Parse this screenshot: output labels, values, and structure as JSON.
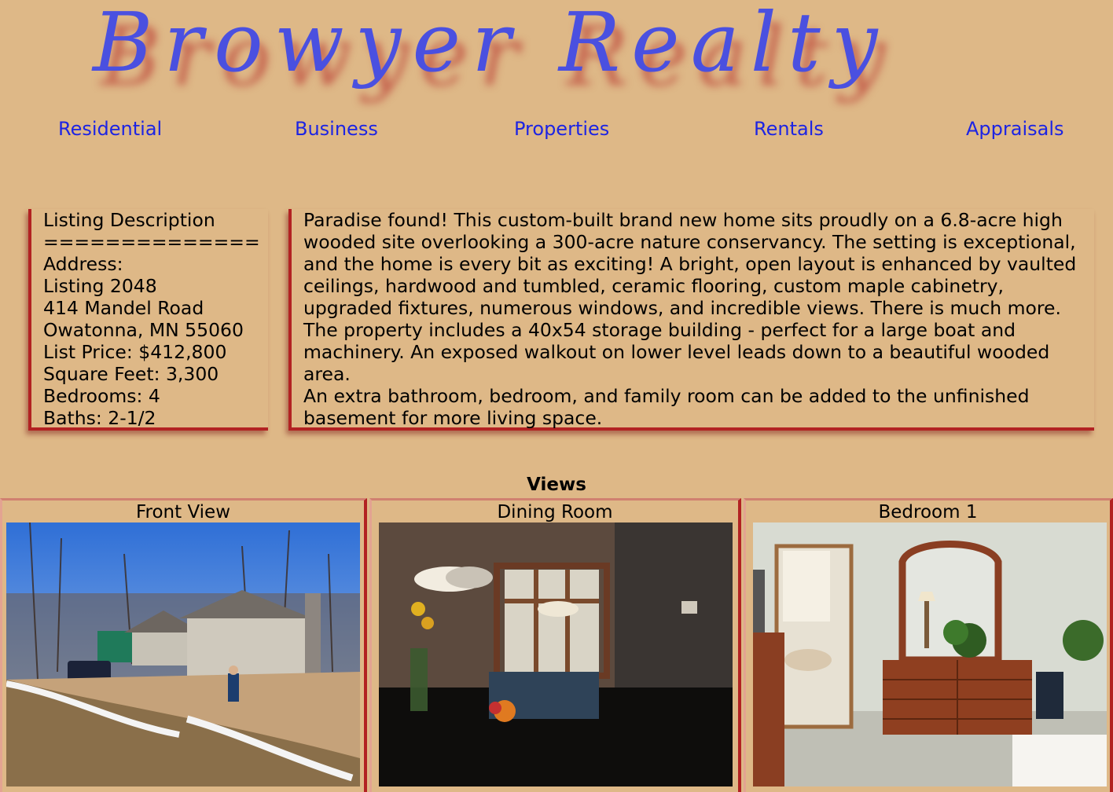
{
  "header": {
    "logo_text": "Browyer Realty"
  },
  "nav": {
    "items": [
      {
        "label": "Residential"
      },
      {
        "label": "Business"
      },
      {
        "label": "Properties"
      },
      {
        "label": "Rentals"
      },
      {
        "label": "Appraisals"
      }
    ]
  },
  "listing": {
    "heading": "Listing Description",
    "separator": "==============",
    "address_label": "Address:",
    "listing_number": "Listing 2048",
    "street": "414 Mandel Road",
    "city_state_zip": "Owatonna, MN 55060",
    "list_price": "List Price: $412,800",
    "square_feet": "Square Feet: 3,300",
    "bedrooms": "Bedrooms: 4",
    "baths": "Baths: 2-1/2"
  },
  "description": {
    "paragraph_1": "Paradise found! This custom-built brand new home sits proudly on a 6.8-acre high wooded site overlooking a 300-acre nature conservancy. The setting is exceptional, and the home is every bit as exciting! A bright, open layout is enhanced by vaulted ceilings, hardwood and tumbled, ceramic flooring, custom maple cabinetry, upgraded fixtures, numerous windows, and incredible views. There is much more. The property includes a 40x54 storage building - perfect for a large boat and machinery. An exposed walkout on lower level leads down to a beautiful wooded area.",
    "paragraph_2": "An extra bathroom, bedroom, and family room can be added to the unfinished basement for more living space."
  },
  "views": {
    "title": "Views",
    "items": [
      {
        "caption": "Front View"
      },
      {
        "caption": "Dining Room"
      },
      {
        "caption": "Bedroom 1"
      }
    ]
  },
  "colors": {
    "background": "#deb887",
    "logo": "#4a50e0",
    "logo_shadow": "#b22222",
    "nav_link": "#1d24e3",
    "box_border": "#b22222"
  }
}
